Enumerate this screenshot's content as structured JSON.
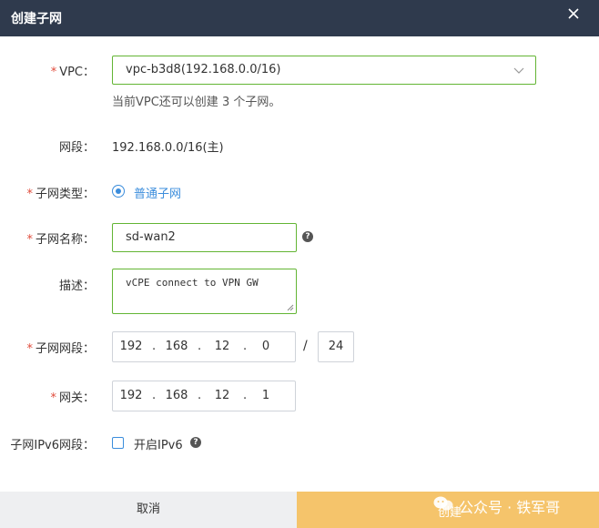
{
  "dialog": {
    "title": "创建子网",
    "close_icon": "close-icon"
  },
  "form": {
    "vpc": {
      "label": "VPC：",
      "value": "vpc-b3d8(192.168.0.0/16)",
      "hint": "当前VPC还可以创建 3 个子网。"
    },
    "segment": {
      "label": "网段：",
      "value": "192.168.0.0/16(主)"
    },
    "subnet_type": {
      "label": "子网类型：",
      "option": "普通子网"
    },
    "subnet_name": {
      "label": "子网名称：",
      "value": "sd-wan2"
    },
    "description": {
      "label": "描述：",
      "value": "vCPE connect to VPN GW"
    },
    "subnet_cidr": {
      "label": "子网网段：",
      "octets": [
        "192",
        "168",
        "12",
        "0"
      ],
      "separator": "/",
      "mask": "24"
    },
    "gateway": {
      "label": "网关：",
      "octets": [
        "192",
        "168",
        "12",
        "1"
      ]
    },
    "ipv6": {
      "label": "子网IPv6网段：",
      "checkbox_label": "开启IPv6"
    },
    "required_mark": "*",
    "dot": "."
  },
  "footer": {
    "cancel_label": "取消",
    "create_label": "创建"
  },
  "watermark": "公众号 · 铁军哥",
  "colors": {
    "titlebar": "#2f3a4d",
    "accent_blue": "#3b8ddc",
    "active_border": "#63b534",
    "required": "#e04b3b",
    "create_button": "#f5c46b"
  }
}
